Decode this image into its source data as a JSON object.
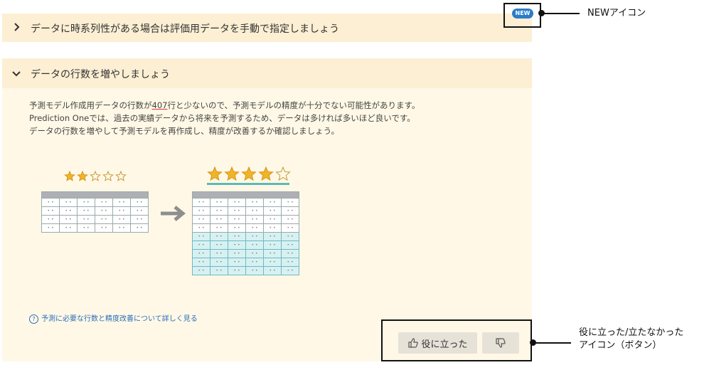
{
  "panel1": {
    "title": "データに時系列性がある場合は評価用データを手動で指定しましょう"
  },
  "new_badge": {
    "label": "NEW"
  },
  "annotations": {
    "new_icon": "NEWアイコン",
    "feedback_line1": "役に立った/立たなかった",
    "feedback_line2": "アイコン（ボタン）"
  },
  "panel2": {
    "title": "データの行数を増やしましょう",
    "desc_line1_pre": "予測モデル作成用データの行数が",
    "desc_line1_count": "407",
    "desc_line1_post": "行と少ないので、予測モデルの精度が十分でない可能性があります。",
    "desc_line2": "Prediction Oneでは、過去の実績データから将来を予測するため、データは多ければ多いほど良いです。",
    "desc_line3": "データの行数を増やして予測モデルを再作成し、精度が改善するか確認しましょう。",
    "help_link": "予測に必要な行数と精度改善について詳しく見る",
    "helpful_button": "役に立った"
  },
  "illustration": {
    "before_rating": 2,
    "after_rating": 4,
    "max_rating": 5,
    "cell_mark": "• •",
    "star_color": "#f0b429",
    "teal_color": "#5fb8b8"
  }
}
